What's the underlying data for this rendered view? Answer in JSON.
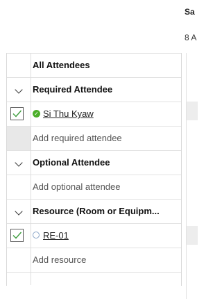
{
  "schedule": {
    "date_header": "Sa",
    "date_sub": "8 A"
  },
  "grid": {
    "header": "All Attendees",
    "required_section": "Required Attendee",
    "required_attendee": {
      "name": "Si Thu Kyaw",
      "status": "accepted",
      "checked": true
    },
    "add_required": "Add required attendee",
    "optional_section": "Optional Attendee",
    "add_optional": "Add optional attendee",
    "resource_section": "Resource (Room or Equipm...",
    "resource_item": {
      "name": "RE-01",
      "checked": true
    },
    "add_resource": "Add resource"
  },
  "colors": {
    "accepted_green": "#4caf2a",
    "checkbox_check": "#3b9c3b",
    "busy_band": "#ededed"
  }
}
